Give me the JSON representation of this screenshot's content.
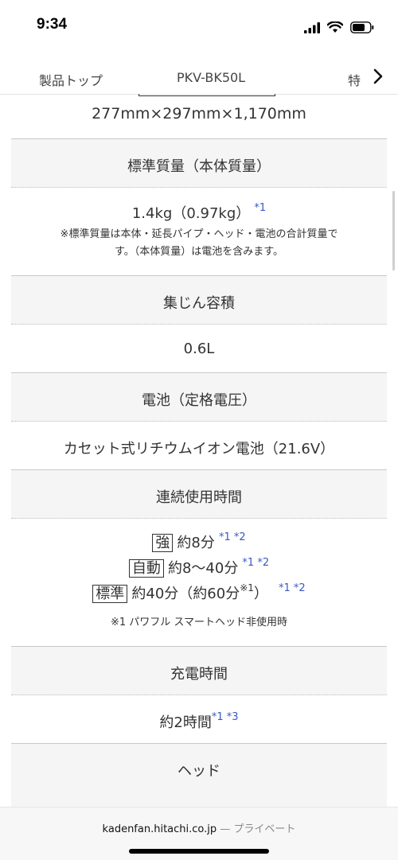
{
  "status_bar": {
    "time": "9:34"
  },
  "tabs": [
    {
      "label": "製品トップ"
    },
    {
      "label": "PKV-BK50L"
    },
    {
      "label": "特"
    }
  ],
  "specs": {
    "size_value": "277mm×297mm×1,170mm",
    "weight_header": "標準質量（本体質量）",
    "weight_value": "1.4kg（0.97kg）",
    "weight_ref": "*1",
    "weight_note_1": "※標準質量は本体・延長パイプ・ヘッド・電池の合計質量で",
    "weight_note_2": "す。（本体質量）は電池を含みます。",
    "dust_header": "集じん容積",
    "dust_value": "0.6L",
    "battery_header": "電池（定格電圧）",
    "battery_value": "カセット式リチウムイオン電池（21.6V）",
    "runtime_header": "連続使用時間",
    "runtime_1_mode": "強",
    "runtime_1_value": "約8分",
    "runtime_1_ref": "*1 *2",
    "runtime_2_mode": "自動",
    "runtime_2_value": "約8〜40分",
    "runtime_2_ref": "*1 *2",
    "runtime_3_mode": "標準",
    "runtime_3_value": "約40分（約60分",
    "runtime_3_sup": "※1",
    "runtime_3_close": "）",
    "runtime_3_ref": "*1 *2",
    "runtime_note": "※1 パワフル スマートヘッド非使用時",
    "charge_header": "充電時間",
    "charge_value": "約2時間",
    "charge_ref": "*1 *3",
    "head_header": "ヘッド"
  },
  "browser": {
    "domain": "kadenfan.hitachi.co.jp",
    "separator": "—",
    "mode": "プライベート"
  }
}
